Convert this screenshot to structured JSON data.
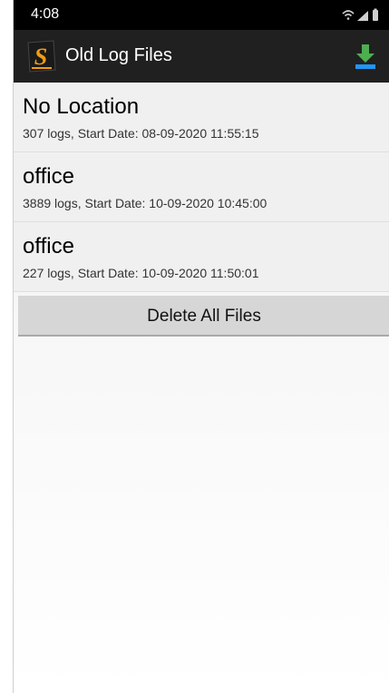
{
  "status_bar": {
    "time": "4:08",
    "icons": [
      "wifi-icon",
      "signal-icon",
      "battery-icon"
    ]
  },
  "app_bar": {
    "logo_letter": "S",
    "title": "Old Log Files",
    "action_icon": "download-icon"
  },
  "files": [
    {
      "title": "No Location",
      "subtitle": "307 logs, Start Date: 08-09-2020 11:55:15"
    },
    {
      "title": "office",
      "subtitle": "3889 logs, Start Date: 10-09-2020 10:45:00"
    },
    {
      "title": "office",
      "subtitle": "227 logs, Start Date: 10-09-2020 11:50:01"
    }
  ],
  "delete_all_label": "Delete All Files",
  "colors": {
    "status_bar_bg": "#000000",
    "app_bar_bg": "#202020",
    "logo_orange": "#f39c12",
    "download_green": "#4caf50",
    "download_blue": "#2196f3"
  }
}
